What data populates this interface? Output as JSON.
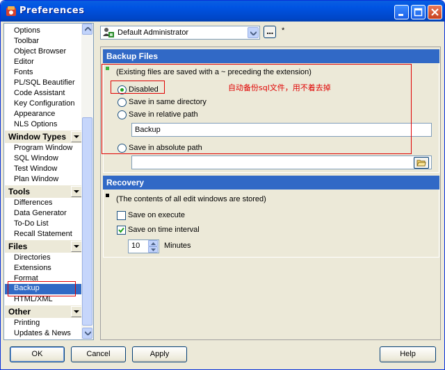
{
  "window": {
    "title": "Preferences"
  },
  "nav": {
    "groups": [
      {
        "items": [
          "Options",
          "Toolbar",
          "Object Browser",
          "Editor",
          "Fonts",
          "PL/SQL Beautifier",
          "Code Assistant",
          "Key Configuration",
          "Appearance",
          "NLS Options"
        ]
      },
      {
        "header": "Window Types",
        "items": [
          "Program Window",
          "SQL Window",
          "Test Window",
          "Plan Window"
        ]
      },
      {
        "header": "Tools",
        "items": [
          "Differences",
          "Data Generator",
          "To-Do List",
          "Recall Statement"
        ]
      },
      {
        "header": "Files",
        "items": [
          "Directories",
          "Extensions",
          "Format",
          "Backup",
          "HTML/XML"
        ]
      },
      {
        "header": "Other",
        "items": [
          "Printing",
          "Updates & News"
        ]
      }
    ],
    "selected": "Backup"
  },
  "toolbar": {
    "profile": "Default Administrator",
    "dots": "...",
    "modified_marker": "*"
  },
  "backup": {
    "header": "Backup Files",
    "note": "(Existing files are saved with a ~ preceding the extension)",
    "options": [
      "Disabled",
      "Save in same directory",
      "Save in relative path",
      "Save in absolute path"
    ],
    "selected_option": "Disabled",
    "relative_path_value": "Backup",
    "absolute_path_value": ""
  },
  "recovery": {
    "header": "Recovery",
    "note": "(The contents of all edit windows are stored)",
    "save_on_execute_label": "Save on execute",
    "save_on_execute": false,
    "save_on_interval_label": "Save on time interval",
    "save_on_interval": true,
    "interval_value": "10",
    "interval_unit": "Minutes"
  },
  "annotation": {
    "text": "自动备份sql文件，用不着去掉",
    "color": "#e00000"
  },
  "buttons": {
    "ok": "OK",
    "cancel": "Cancel",
    "apply": "Apply",
    "help": "Help"
  },
  "colors": {
    "title_bar": "#0054e3",
    "section_header": "#3169c6",
    "selection": "#316ac5",
    "annotation": "#e00000"
  }
}
